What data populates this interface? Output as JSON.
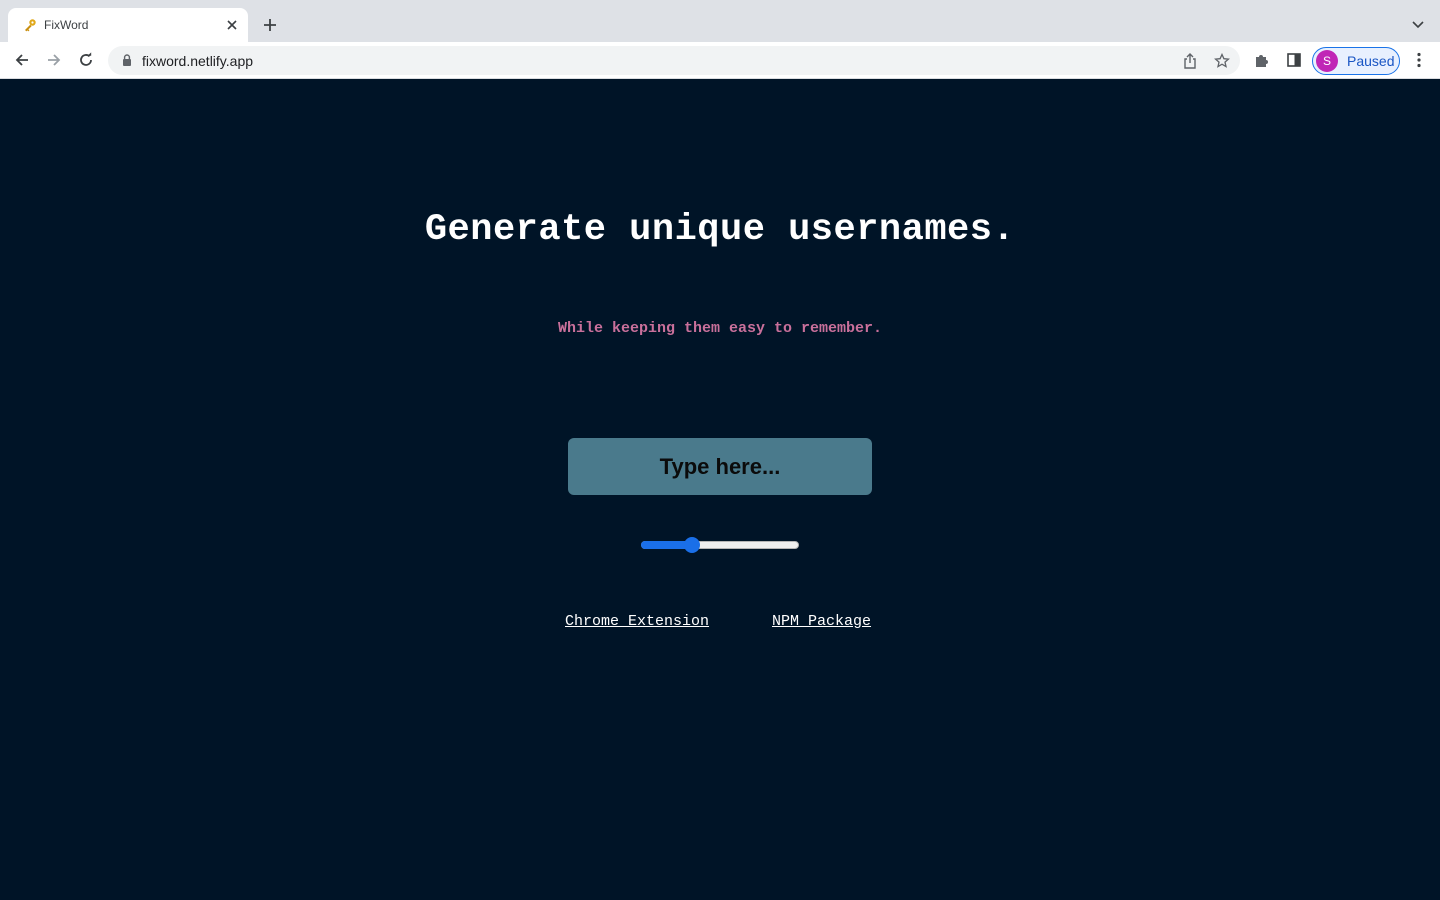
{
  "browser": {
    "tab": {
      "title": "FixWord"
    },
    "address": {
      "url": "fixword.netlify.app"
    },
    "profile": {
      "initial": "S",
      "status": "Paused"
    },
    "accent_color": "#1a73e8"
  },
  "main": {
    "headline": "Generate unique usernames.",
    "subheadline": "While keeping them easy to remember.",
    "input": {
      "placeholder": "Type here...",
      "value": ""
    },
    "slider": {
      "fraction": 0.32
    },
    "links": [
      {
        "label": "Chrome Extension"
      },
      {
        "label": "NPM Package"
      }
    ],
    "colors": {
      "background": "#001427",
      "subheadline": "#c9709b",
      "input_background": "#4a7a8c"
    }
  }
}
